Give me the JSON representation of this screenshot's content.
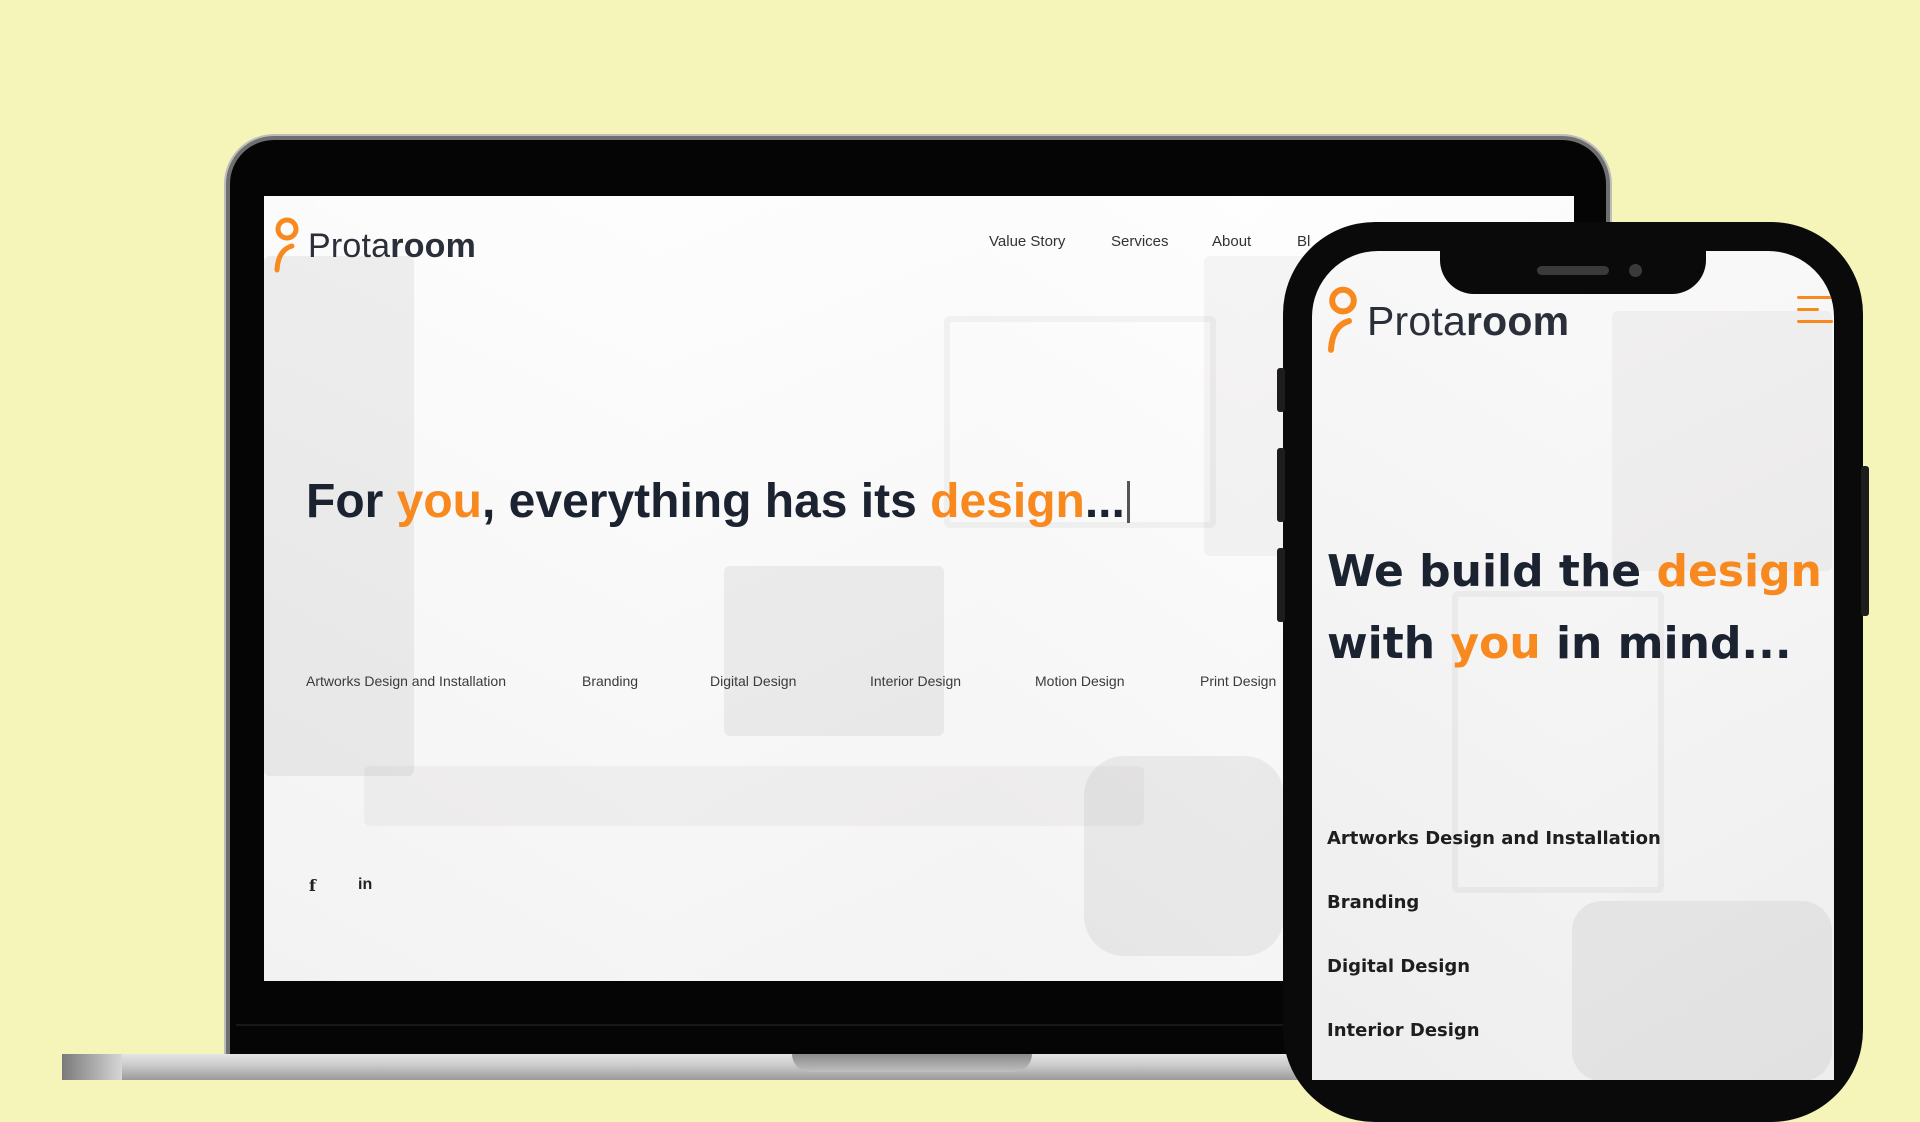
{
  "desktop": {
    "brand": {
      "light": "Prota",
      "bold": "room"
    },
    "nav": [
      "Value Story",
      "Services",
      "About",
      "Bl"
    ],
    "hero": {
      "part1": "For ",
      "part2": "you",
      "part3": ", everything has its ",
      "part4": "design",
      "part5": "..."
    },
    "services": [
      "Artworks Design and Installation",
      "Branding",
      "Digital Design",
      "Interior Design",
      "Motion Design",
      "Print Design"
    ],
    "social": {
      "facebook": "f",
      "linkedin": "in"
    }
  },
  "mobile": {
    "brand": {
      "light": "Prota",
      "bold": "room"
    },
    "hero": {
      "l1a": "We build the ",
      "l1b": "design",
      "l2a": "with ",
      "l2b": "you",
      "l2c": " in mind..."
    },
    "services": [
      "Artworks Design and Installation",
      "Branding",
      "Digital Design",
      "Interior Design"
    ],
    "menu_icon": "hamburger-menu-icon"
  },
  "colors": {
    "accent": "#f7891e",
    "text_dark": "#1c2330",
    "background": "#f5f5b9"
  }
}
